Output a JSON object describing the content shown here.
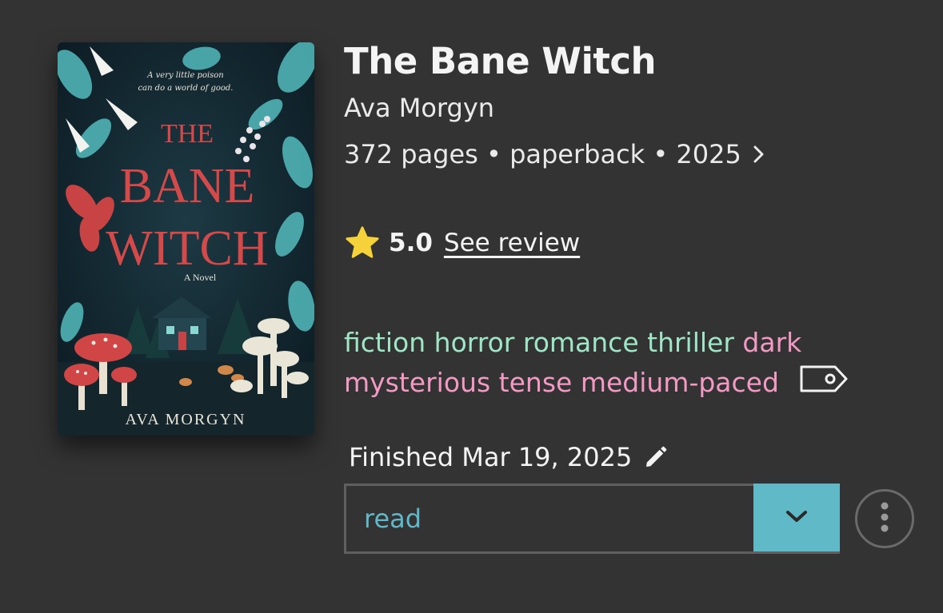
{
  "book": {
    "title": "The Bane Witch",
    "author": "Ava Morgyn",
    "details": "372 pages • paperback • 2025",
    "cover": {
      "tagline_line1": "A very little poison",
      "tagline_line2": "can do a world of good.",
      "title_the": "THE",
      "title_bane": "BANE",
      "title_witch": "WITCH",
      "subtitle": "A Novel",
      "author": "AVA MORGYN"
    }
  },
  "rating": {
    "value": "5.0",
    "review_link": "See review",
    "icon": "star-icon"
  },
  "tags": {
    "genres": [
      "fiction",
      "horror",
      "romance",
      "thriller"
    ],
    "moods": [
      "dark",
      "mysterious",
      "tense",
      "medium-paced"
    ],
    "icon": "tag-icon"
  },
  "status": {
    "finished_label": "Finished Mar 19, 2025",
    "shelf_value": "read"
  },
  "colors": {
    "background": "#333333",
    "genre": "#9ee6c6",
    "mood": "#f39ac4",
    "accent": "#5fb9c7",
    "star": "#f5d23a"
  }
}
